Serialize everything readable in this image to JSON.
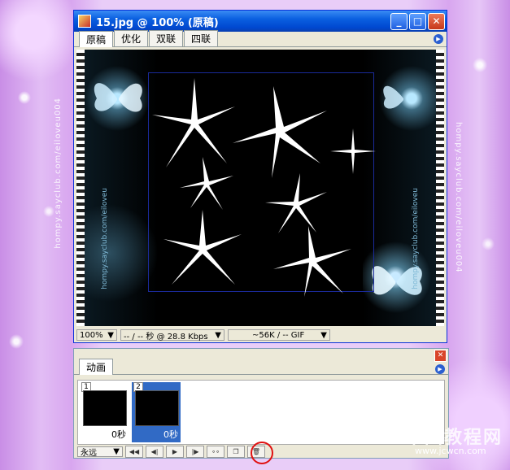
{
  "window": {
    "title": "15.jpg @ 100% (原稿)",
    "controls": {
      "minimize": "_",
      "maximize": "□",
      "close": "✕"
    },
    "tabs": [
      {
        "label": "原稿",
        "active": true
      },
      {
        "label": "优化",
        "active": false
      },
      {
        "label": "双联",
        "active": false
      },
      {
        "label": "四联",
        "active": false
      }
    ],
    "canvas": {
      "side_text_left": "hompy.sayclub.com/eiloveu",
      "side_text_right": "hompy.sayclub.com/eiloveu"
    },
    "status": {
      "zoom": "100%",
      "download_time": "-- / -- 秒 @ 28.8 Kbps",
      "file_info": "~56K / -- GIF"
    }
  },
  "background": {
    "side_text_left": "hompy.sayclub.com/eiloveu004",
    "side_text_right": "hompy.sayclub.com/eiloveu004"
  },
  "animation_panel": {
    "tab": "动画",
    "frames": [
      {
        "number": "1",
        "delay": "0秒",
        "selected": false
      },
      {
        "number": "2",
        "delay": "0秒",
        "selected": true
      }
    ],
    "loop": "永远",
    "controls": [
      "first-frame",
      "prev-frame",
      "play",
      "next-frame",
      "tween",
      "duplicate-frame",
      "delete-frame"
    ]
  },
  "watermark": {
    "text": "中国教程网",
    "url": "www.jcwcn.com"
  }
}
